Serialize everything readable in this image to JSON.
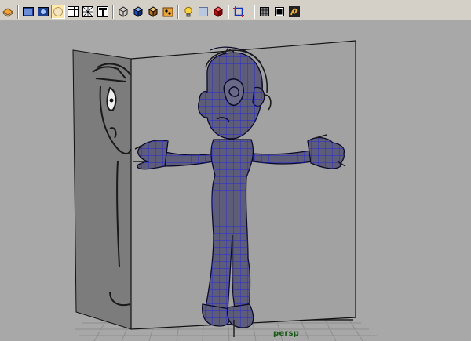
{
  "viewport": {
    "camera_label": "persp"
  },
  "toolbar": {
    "buttons": [
      {
        "icon": "layers-icon"
      },
      {
        "icon": "shaded-view-icon"
      },
      {
        "icon": "textured-view-icon"
      },
      {
        "icon": "sphere-icon"
      },
      {
        "icon": "grid-view-icon"
      },
      {
        "icon": "wireframe-icon"
      },
      {
        "icon": "texture-icon"
      },
      {
        "icon": "cube-wire-icon"
      },
      {
        "icon": "cube-shaded-icon"
      },
      {
        "icon": "cube-textured-icon"
      },
      {
        "icon": "paint-icon"
      },
      {
        "icon": "light-bulb-icon"
      },
      {
        "icon": "shadow-icon"
      },
      {
        "icon": "red-cube-icon"
      },
      {
        "icon": "isolate-icon"
      },
      {
        "icon": "frame-icon"
      },
      {
        "icon": "xray-icon"
      },
      {
        "icon": "resolution-gate-icon"
      },
      {
        "icon": "snapshot-icon"
      }
    ]
  },
  "colors": {
    "viewport_bg": "#a8a8a8",
    "mesh_fill": "#5d5d7a",
    "mesh_wire": "#1f1fe0",
    "camera_label": "#1a5b1a",
    "toolbar_bg": "#d4d0c8"
  }
}
